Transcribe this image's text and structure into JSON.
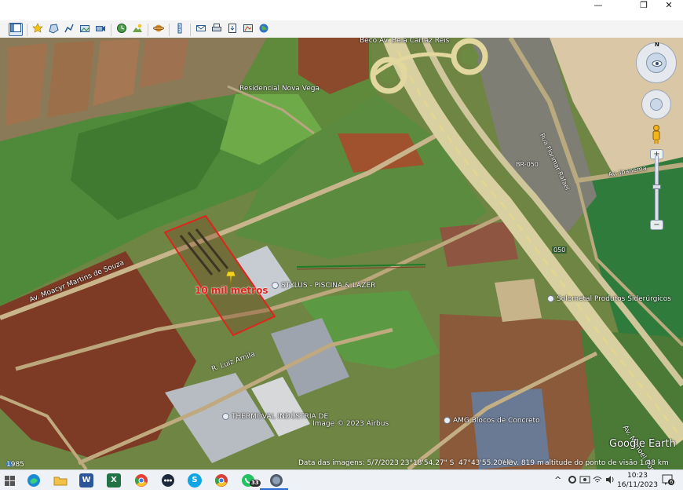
{
  "window": {
    "controls": {
      "minimize": "—",
      "maximize": "❐",
      "close": "✕"
    }
  },
  "toolbar": {
    "buttons": [
      {
        "name": "sidebar-toggle",
        "icon": "sidebar-icon"
      },
      {
        "name": "add-placemark",
        "icon": "placemark-icon"
      },
      {
        "name": "add-polygon",
        "icon": "polygon-icon"
      },
      {
        "name": "add-path",
        "icon": "path-icon"
      },
      {
        "name": "add-image-overlay",
        "icon": "image-overlay-icon"
      },
      {
        "name": "record-tour",
        "icon": "record-tour-icon"
      },
      {
        "name": "historical-imagery",
        "icon": "clock-icon"
      },
      {
        "name": "sunlight",
        "icon": "sun-icon"
      },
      {
        "name": "switch-planet",
        "icon": "planet-icon"
      },
      {
        "name": "ruler",
        "icon": "ruler-icon"
      },
      {
        "name": "email",
        "icon": "email-icon"
      },
      {
        "name": "print",
        "icon": "print-icon"
      },
      {
        "name": "save-image",
        "icon": "save-image-icon"
      },
      {
        "name": "view-in-maps",
        "icon": "maps-icon"
      },
      {
        "name": "earth",
        "icon": "earth-icon"
      }
    ]
  },
  "map": {
    "labels": {
      "top_center": "Beco Av. Bela Cartaz Reis",
      "residential": "Residencial Nova Vega",
      "road_left": "Av. Moacyr Martins de Souza",
      "poi_stylus": "STYLUS - PISCINA & LAZER",
      "poi_solometal": "Solometal Produtos Siderúrgicos",
      "poi_thermoval": "THERMOVAL INDÚSTRIA DE",
      "poi_amg": "AMG Blocos de Concreto",
      "road_br050_top": "BR-050",
      "road_050": "050",
      "road_rua": "R. Luiz Arnila",
      "road_bottom_right": "Av. Manoel Conte",
      "road_service": "Rua Florimar Rafael",
      "road_right_top": "Av. Ipanema",
      "copyright": "Image © 2023 Airbus",
      "parcel_label": "10 mil metros"
    },
    "brand": "Google Earth",
    "colors": {
      "parcel_outline": "#e0231c",
      "parcel_label": "#e0231c",
      "pin": "#f3d421",
      "measure_line": "#1f7a2a"
    }
  },
  "status": {
    "year": "1985",
    "imagery_date": "Data das imagens: 5/7/2023",
    "lat": "23°18'54.27\" S",
    "lon": "47°43'55.20\" O",
    "elev": "elev. 819 m",
    "eye_alt": "altitude do ponto de visão  1.48 km"
  },
  "taskbar": {
    "apps": [
      {
        "name": "start",
        "icon": "windows-icon",
        "color": "#1f6fd1"
      },
      {
        "name": "search",
        "icon": "search-icon",
        "color": "#555"
      },
      {
        "name": "edge",
        "icon": "edge-icon",
        "color": "#1a8ad4"
      },
      {
        "name": "explorer",
        "icon": "folder-icon",
        "color": "#e8b424"
      },
      {
        "name": "word",
        "icon": "word-icon",
        "color": "#2b579a",
        "letter": "W"
      },
      {
        "name": "excel",
        "icon": "excel-icon",
        "color": "#217346",
        "letter": "X"
      },
      {
        "name": "chrome",
        "icon": "chrome-icon",
        "color": "#e44134"
      },
      {
        "name": "app-dots",
        "icon": "dots-icon",
        "color": "#1e2a3a"
      },
      {
        "name": "skype",
        "icon": "skype-icon",
        "color": "#12a5e4",
        "letter": "S"
      },
      {
        "name": "chrome2",
        "icon": "chrome-icon",
        "color": "#d7403a"
      },
      {
        "name": "whatsapp",
        "icon": "whatsapp-icon",
        "color": "#25c264",
        "badge": "33"
      },
      {
        "name": "google-earth",
        "icon": "google-earth-icon",
        "color": "#4f5c6b"
      }
    ],
    "tray": {
      "chevron": "^",
      "time": "10:23",
      "date": "16/11/2023",
      "notifications": "6"
    }
  }
}
